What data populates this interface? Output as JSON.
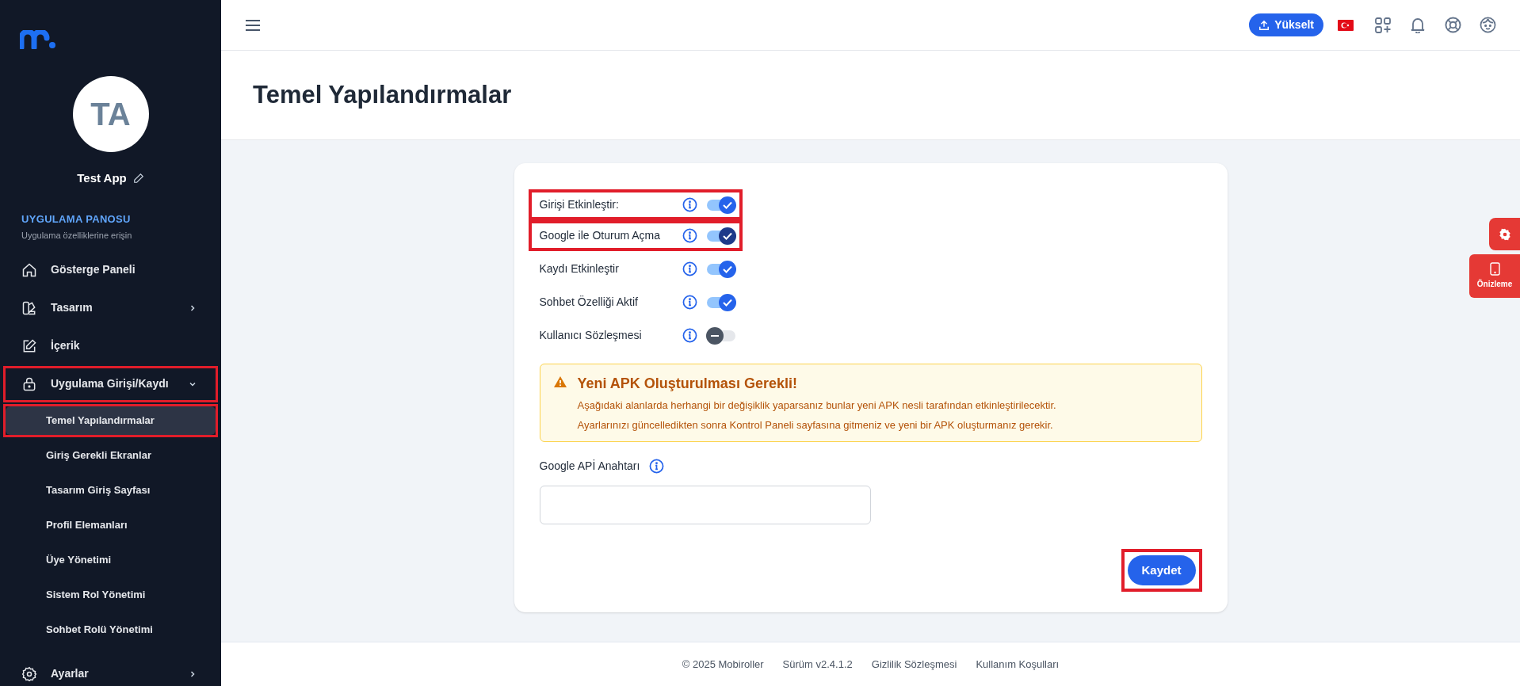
{
  "sidebar": {
    "app_initials": "TA",
    "app_name": "Test App",
    "section_title": "UYGULAMA PANOSU",
    "section_subtitle": "Uygulama özelliklerine erişin",
    "items": [
      {
        "label": "Gösterge Paneli",
        "highlighted": false
      },
      {
        "label": "Tasarım",
        "expanded": false,
        "highlighted": false
      },
      {
        "label": "İçerik",
        "highlighted": false
      },
      {
        "label": "Uygulama Girişi/Kaydı",
        "expanded": true,
        "highlighted": true,
        "children": [
          {
            "label": "Temel Yapılandırmalar",
            "selected": true,
            "highlighted": true
          },
          {
            "label": "Giriş Gerekli Ekranlar",
            "selected": false,
            "highlighted": false
          },
          {
            "label": "Tasarım Giriş Sayfası",
            "selected": false,
            "highlighted": false
          },
          {
            "label": "Profil Elemanları",
            "selected": false,
            "highlighted": false
          },
          {
            "label": "Üye Yönetimi",
            "selected": false,
            "highlighted": false
          },
          {
            "label": "Sistem Rol Yönetimi",
            "selected": false,
            "highlighted": false
          },
          {
            "label": "Sohbet Rolü Yönetimi",
            "selected": false,
            "highlighted": false
          }
        ]
      },
      {
        "label": "Ayarlar",
        "expanded": false,
        "highlighted": false
      }
    ]
  },
  "topbar": {
    "upgrade_button": "Yükselt"
  },
  "page_title": "Temel Yapılandırmalar",
  "settings": [
    {
      "label": "Girişi Etkinleştir:",
      "on": true,
      "focused": false,
      "highlighted": true
    },
    {
      "label": "Google ile Oturum Açma",
      "on": true,
      "focused": true,
      "highlighted": true
    },
    {
      "label": "Kaydı Etkinleştir",
      "on": true,
      "focused": false,
      "highlighted": false
    },
    {
      "label": "Sohbet Özelliği Aktif",
      "on": true,
      "focused": false,
      "highlighted": false
    },
    {
      "label": "Kullanıcı Sözleşmesi",
      "on": false,
      "focused": false,
      "highlighted": false
    }
  ],
  "alert": {
    "title": "Yeni APK Oluşturulması Gerekli!",
    "lines": [
      "Aşağıdaki alanlarda herhangi bir değişiklik yaparsanız bunlar yeni APK nesli tarafından etkinleştirilecektir.",
      "Ayarlarınızı güncelledikten sonra Kontrol Paneli sayfasına gitmeniz ve yeni bir APK oluşturmanız gerekir."
    ]
  },
  "api_key": {
    "label": "Google APİ Anahtarı"
  },
  "save_button": {
    "label": "Kaydet",
    "highlighted": true
  },
  "side_buttons": {
    "preview": "Önizleme"
  },
  "footer": [
    "© 2025 Mobiroller",
    "Sürüm v2.4.1.2",
    "Gizlilik Sözleşmesi",
    "Kullanım Koşulları"
  ]
}
